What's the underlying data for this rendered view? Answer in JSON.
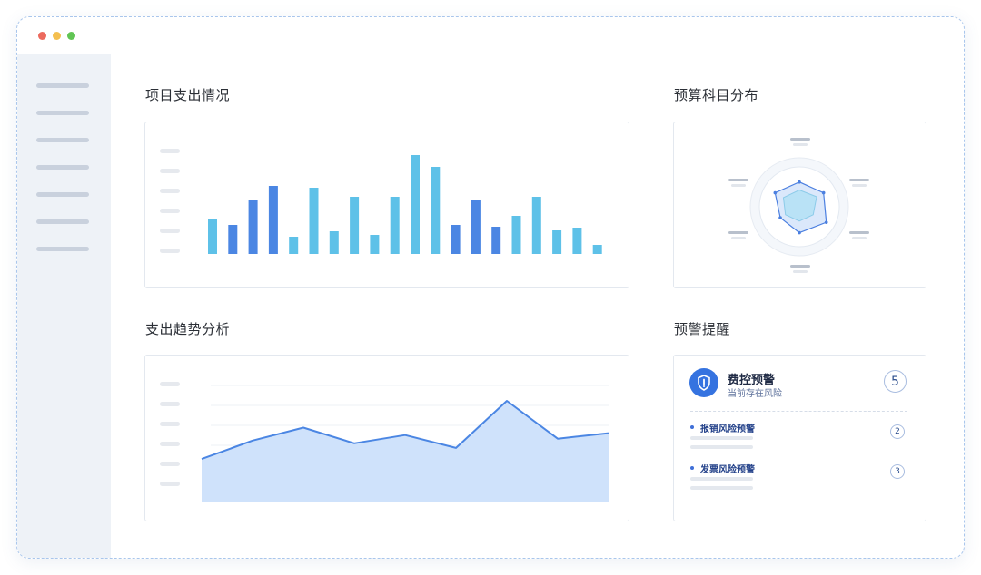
{
  "sidebar": {
    "items": [
      "",
      "",
      "",
      "",
      "",
      "",
      ""
    ]
  },
  "sections": {
    "expense": {
      "title": "项目支出情况"
    },
    "budget": {
      "title": "预算科目分布"
    },
    "trend": {
      "title": "支出趋势分析"
    },
    "alerts": {
      "title": "预警提醒"
    }
  },
  "alerts": {
    "title": "费控预警",
    "subtitle": "当前存在风险",
    "total": "5",
    "items": [
      {
        "label": "报销风险预警",
        "count": "2"
      },
      {
        "label": "发票风险预警",
        "count": "3"
      }
    ]
  },
  "colors": {
    "bar_light": "#5ec1e8",
    "bar_dark": "#4b86e3",
    "area_fill": "#cfe2fb",
    "line": "#4b86e3"
  },
  "chart_data": [
    {
      "type": "bar",
      "values": [
        38,
        32,
        60,
        75,
        19,
        73,
        25,
        63,
        21,
        63,
        109,
        96,
        32,
        60,
        30,
        42,
        63,
        26,
        29,
        10
      ],
      "series_color_index": [
        "light",
        "dark",
        "dark",
        "dark",
        "light",
        "light",
        "light",
        "light",
        "light",
        "light",
        "light",
        "light",
        "dark",
        "dark",
        "dark",
        "light",
        "light",
        "light",
        "light",
        "light"
      ]
    },
    {
      "type": "area",
      "values": [
        47,
        67,
        81,
        64,
        73,
        59,
        110,
        69,
        75
      ]
    },
    {
      "type": "radar",
      "outer": [
        0.62,
        0.7,
        0.78,
        0.65,
        0.55,
        0.7
      ],
      "inner": [
        0.42,
        0.5,
        0.4,
        0.36,
        0.4,
        0.46
      ]
    }
  ]
}
